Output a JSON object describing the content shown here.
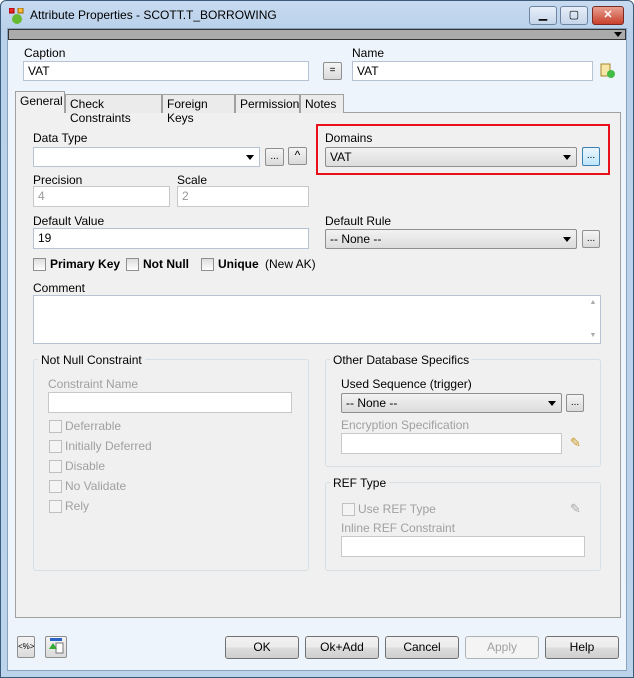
{
  "window": {
    "title": "Attribute Properties - SCOTT.T_BORROWING"
  },
  "header": {
    "caption_label": "Caption",
    "caption_value": "VAT",
    "equal_label": "=",
    "name_label": "Name",
    "name_value": "VAT"
  },
  "tabs": [
    {
      "label": "General",
      "active": true
    },
    {
      "label": "Check Constraints"
    },
    {
      "label": "Foreign Keys"
    },
    {
      "label": "Permissions"
    },
    {
      "label": "Notes"
    }
  ],
  "general": {
    "data_type_label": "Data Type",
    "data_type_value": "",
    "ellipsis": "...",
    "caret": "^",
    "domains_label": "Domains",
    "domains_value": "VAT",
    "precision_label": "Precision",
    "precision_value": "4",
    "scale_label": "Scale",
    "scale_value": "2",
    "default_value_label": "Default Value",
    "default_value": "19",
    "default_rule_label": "Default Rule",
    "default_rule_value": "-- None --",
    "primary_key": "Primary Key",
    "not_null": "Not Null",
    "unique": "Unique",
    "new_ak": "(New AK)",
    "comment_label": "Comment",
    "comment_value": ""
  },
  "not_null_constraint": {
    "title": "Not Null Constraint",
    "constraint_name_label": "Constraint Name",
    "options": [
      "Deferrable",
      "Initially Deferred",
      "Disable",
      "No Validate",
      "Rely"
    ]
  },
  "other_db": {
    "title": "Other Database Specifics",
    "used_sequence_label": "Used Sequence (trigger)",
    "used_sequence_value": "-- None --",
    "encryption_label": "Encryption Specification"
  },
  "ref_type": {
    "title": "REF Type",
    "use_ref_type": "Use REF Type",
    "inline_ref_label": "Inline REF Constraint"
  },
  "footer": {
    "var_icon_label": "<%>",
    "ok": "OK",
    "ok_add": "Ok+Add",
    "cancel": "Cancel",
    "apply": "Apply",
    "help": "Help"
  },
  "colors": {
    "highlight": "#e8101a"
  }
}
